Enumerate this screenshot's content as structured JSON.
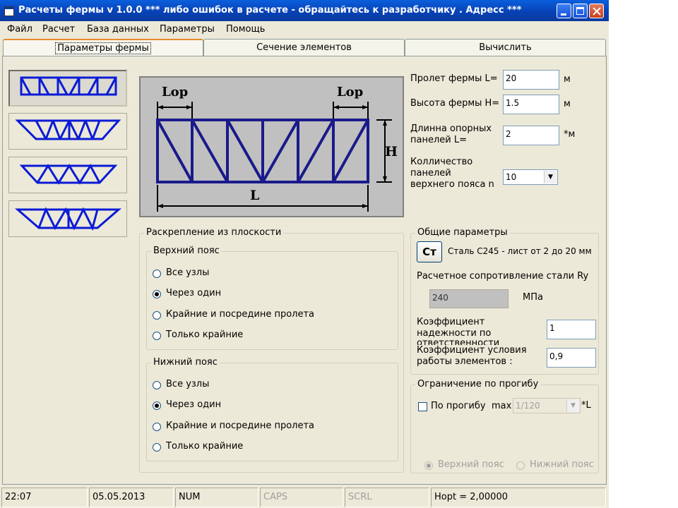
{
  "window": {
    "title": "Расчеты фермы v 1.0.0 *** либо ошибок в расчете - обращайтесь к разработчику . Адресс  ***"
  },
  "menu": [
    "Файл",
    "Расчет",
    "База данных",
    "Параметры",
    "Помощь"
  ],
  "tabs": [
    "Параметры фермы",
    "Сечение элементов",
    "Вычислить"
  ],
  "diagram": {
    "lop_left": "Lop",
    "lop_right": "Lop",
    "height_label": "H",
    "span_label": "L"
  },
  "truss_params": {
    "span_label": "Пролет фермы L=",
    "span_value": "20",
    "span_unit": "м",
    "height_label": "Высота фермы H=",
    "height_value": "1.5",
    "height_unit": "м",
    "panel_len_label_1": "Длинна опорных",
    "panel_len_label_2": "панелей  L=",
    "panel_len_value": "2",
    "panel_len_unit": "*м",
    "panel_count_label_1": "Колличество",
    "panel_count_label_2": "панелей",
    "panel_count_label_3": "верхнего пояса n",
    "panel_count_value": "10"
  },
  "bracing": {
    "title": "Раскрепление из плоскости",
    "top_chord": {
      "title": "Верхний пояс",
      "options": [
        "Все узлы",
        "Через один",
        "Крайние и посредине пролета",
        "Только крайние"
      ],
      "selected": 1
    },
    "bottom_chord": {
      "title": "Нижний пояс",
      "options": [
        "Все узлы",
        "Через один",
        "Крайние и посредине пролета",
        "Только крайние"
      ],
      "selected": 1
    }
  },
  "general": {
    "title": "Общие параметры",
    "steel_button": "Ст",
    "steel_text": "Сталь С245 - лист от 2 до 20 мм",
    "ry_label": "Расчетное сопротивление стали Ry",
    "ry_value": "240",
    "ry_unit": "МПа",
    "k_rel_label_1": "Коэффициент",
    "k_rel_label_2": "надежности по",
    "k_rel_label_3": "ответственности",
    "k_rel_value": "1",
    "k_work_label_1": "Коэффициент условия",
    "k_work_label_2": "работы элементов :",
    "k_work_value": "0,9"
  },
  "deflection": {
    "title": "Ограничение по прогибу",
    "check_label": "По прогибу",
    "max_label": "max",
    "max_value": "1/120",
    "unit": "*L",
    "radio_top": "Верхний пояс",
    "radio_bottom": "Нижний пояс"
  },
  "status": {
    "time": "22:07",
    "date": "05.05.2013",
    "num": "NUM",
    "caps": "CAPS",
    "scrl": "SCRL",
    "hopt": "Hopt = 2,00000"
  },
  "colors": {
    "truss_stroke": "#1a1a8c",
    "thumb_stroke": "#0b1bd6",
    "title_bar": "#0842b6"
  }
}
